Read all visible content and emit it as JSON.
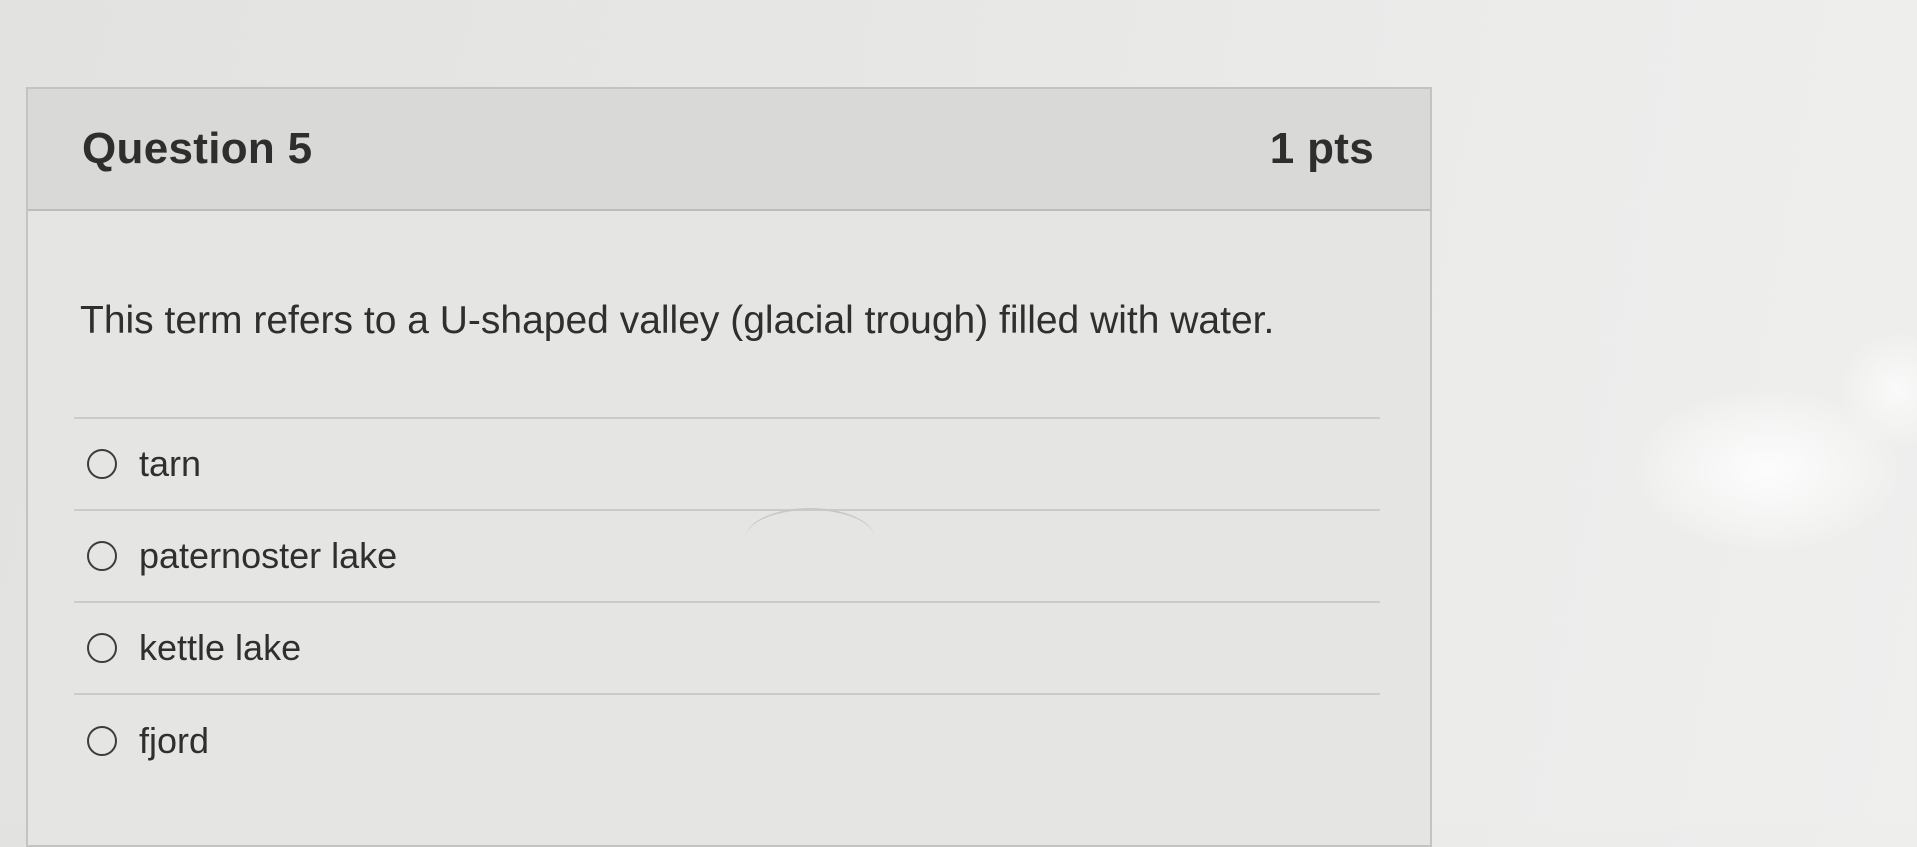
{
  "question": {
    "title": "Question 5",
    "points": "1 pts",
    "text": "This term refers to a U-shaped valley (glacial trough) filled with water."
  },
  "answers": [
    {
      "label": "tarn"
    },
    {
      "label": "paternoster lake"
    },
    {
      "label": "kettle lake"
    },
    {
      "label": "fjord"
    }
  ]
}
